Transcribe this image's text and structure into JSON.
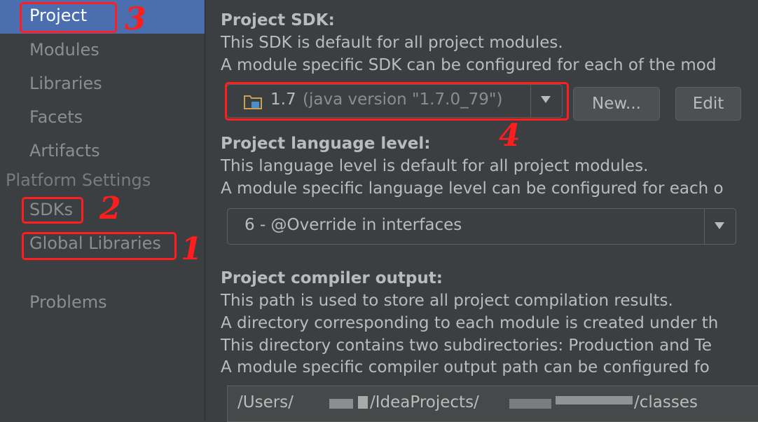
{
  "sidebar": {
    "items": [
      {
        "label": "Project"
      },
      {
        "label": "Modules"
      },
      {
        "label": "Libraries"
      },
      {
        "label": "Facets"
      },
      {
        "label": "Artifacts"
      }
    ],
    "platform_header": "Platform Settings",
    "platform_items": [
      {
        "label": "SDKs"
      },
      {
        "label": "Global Libraries"
      }
    ],
    "problems": "Problems"
  },
  "sdk": {
    "title": "Project SDK:",
    "desc1": "This SDK is default for all project modules.",
    "desc2": "A module specific SDK can be configured for each of the mod",
    "version": "1.7",
    "version_detail": "(java version \"1.7.0_79\")",
    "new_label": "New...",
    "edit_label": "Edit"
  },
  "lang": {
    "title": "Project language level:",
    "desc1": "This language level is default for all project modules.",
    "desc2": "A module specific language level can be configured for each o",
    "value": "6 - @Override in interfaces"
  },
  "output": {
    "title": "Project compiler output:",
    "desc1": "This path is used to store all project compilation results.",
    "desc2": "A directory corresponding to each module is created under th",
    "desc3": "This directory contains two subdirectories: Production and Te",
    "desc4": "A module specific compiler output path can be configured fo",
    "path_start": "/Users/",
    "path_mid": "/IdeaProjects/",
    "path_end": "/classes"
  },
  "annotations": [
    "3",
    "2",
    "1",
    "4"
  ],
  "colors": {
    "background": "#3c3f41",
    "selection": "#4b6eaf",
    "annotation": "#ff1d1d"
  },
  "icons": [
    "folder-icon",
    "chevron-down-icon"
  ]
}
